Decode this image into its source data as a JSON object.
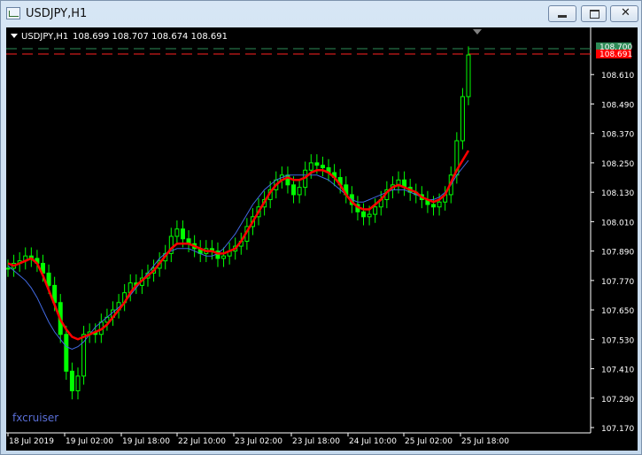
{
  "window": {
    "title": "USDJPY,H1"
  },
  "chart_header": {
    "symbol": "USDJPY,H1",
    "ohlc": "108.699 108.707 108.674 108.691"
  },
  "watermark": "fxcruiser",
  "price_labels": {
    "ask": "108.700",
    "bid": "108.691"
  },
  "colors": {
    "background": "#000000",
    "candles": "#00ff00",
    "ma_fast": "#ff0000",
    "ma_slow": "#4169e1",
    "ask_line": "#2e8b57",
    "bid_line": "#ff0000"
  },
  "chart_data": {
    "type": "bar",
    "title": "USDJPY,H1",
    "y_ticks": [
      "108.610",
      "108.490",
      "108.370",
      "108.250",
      "108.130",
      "108.010",
      "107.890",
      "107.770",
      "107.650",
      "107.530",
      "107.410",
      "107.290",
      "107.170"
    ],
    "x_ticks": [
      "18 Jul 2019",
      "19 Jul 02:00",
      "19 Jul 18:00",
      "22 Jul 10:00",
      "23 Jul 02:00",
      "23 Jul 18:00",
      "24 Jul 10:00",
      "25 Jul 02:00",
      "25 Jul 18:00"
    ],
    "ylim": [
      107.17,
      108.73
    ],
    "grid": false,
    "series": [
      {
        "name": "close",
        "values": [
          107.82,
          107.84,
          107.85,
          107.87,
          107.86,
          107.84,
          107.8,
          107.75,
          107.68,
          107.55,
          107.4,
          107.32,
          107.38,
          107.55,
          107.56,
          107.55,
          107.6,
          107.62,
          107.65,
          107.68,
          107.72,
          107.76,
          107.75,
          107.78,
          107.8,
          107.82,
          107.85,
          107.88,
          107.95,
          107.98,
          107.94,
          107.92,
          107.9,
          107.88,
          107.9,
          107.89,
          107.86,
          107.87,
          107.89,
          107.91,
          107.93,
          107.99,
          108.03,
          108.07,
          108.1,
          108.14,
          108.18,
          108.2,
          108.16,
          108.12,
          108.15,
          108.22,
          108.25,
          108.24,
          108.23,
          108.21,
          108.19,
          108.16,
          108.12,
          108.08,
          108.05,
          108.03,
          108.04,
          108.07,
          108.1,
          108.14,
          108.16,
          108.18,
          108.15,
          108.13,
          108.12,
          108.1,
          108.08,
          108.07,
          108.09,
          108.12,
          108.2,
          108.34,
          108.52,
          108.69
        ]
      },
      {
        "name": "ma_fast",
        "values": [
          107.84,
          107.83,
          107.84,
          107.85,
          107.86,
          107.84,
          107.79,
          107.73,
          107.67,
          107.61,
          107.57,
          107.54,
          107.53,
          107.54,
          107.55,
          107.56,
          107.57,
          107.59,
          107.62,
          107.65,
          107.68,
          107.72,
          107.75,
          107.77,
          107.79,
          107.81,
          107.84,
          107.87,
          107.9,
          107.92,
          107.92,
          107.92,
          107.91,
          107.9,
          107.89,
          107.89,
          107.88,
          107.88,
          107.89,
          107.9,
          107.93,
          107.97,
          108.01,
          108.05,
          108.09,
          108.13,
          108.16,
          108.18,
          108.19,
          108.18,
          108.18,
          108.19,
          108.21,
          108.22,
          108.22,
          108.21,
          108.19,
          108.16,
          108.12,
          108.09,
          108.07,
          108.06,
          108.06,
          108.08,
          108.1,
          108.13,
          108.15,
          108.16,
          108.15,
          108.14,
          108.13,
          108.11,
          108.1,
          108.09,
          108.1,
          108.12,
          108.17,
          108.22,
          108.26,
          108.3
        ]
      },
      {
        "name": "ma_slow",
        "values": [
          107.83,
          107.81,
          107.79,
          107.77,
          107.74,
          107.7,
          107.65,
          107.6,
          107.56,
          107.53,
          107.5,
          107.49,
          107.5,
          107.52,
          107.55,
          107.58,
          107.6,
          107.62,
          107.64,
          107.66,
          107.68,
          107.71,
          107.74,
          107.77,
          107.8,
          107.83,
          107.86,
          107.88,
          107.89,
          107.9,
          107.9,
          107.9,
          107.89,
          107.88,
          107.87,
          107.87,
          107.88,
          107.9,
          107.93,
          107.96,
          108.0,
          108.04,
          108.08,
          108.11,
          108.14,
          108.16,
          108.18,
          108.19,
          108.2,
          108.2,
          108.2,
          108.2,
          108.2,
          108.2,
          108.19,
          108.18,
          108.16,
          108.14,
          108.12,
          108.1,
          108.09,
          108.09,
          108.1,
          108.11,
          108.12,
          108.13,
          108.14,
          108.14,
          108.14,
          108.13,
          108.12,
          108.11,
          108.1,
          108.1,
          108.11,
          108.13,
          108.16,
          108.2,
          108.23,
          108.26
        ]
      }
    ]
  }
}
